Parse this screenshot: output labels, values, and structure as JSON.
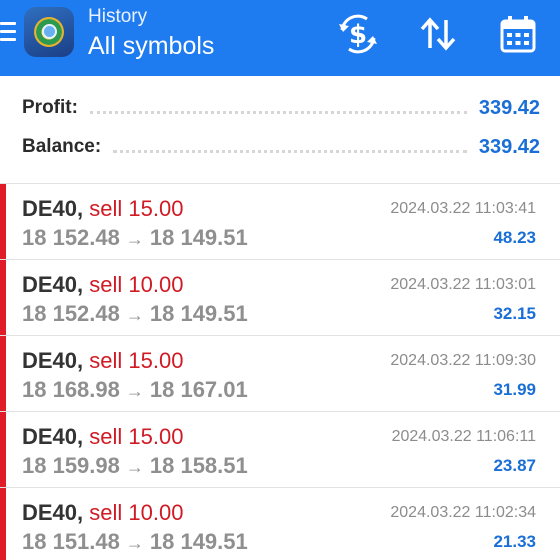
{
  "header": {
    "subtitle": "History",
    "title": "All symbols",
    "icons": [
      "menu-icon",
      "app-logo",
      "currency-exchange-icon",
      "sort-icon",
      "calendar-icon"
    ],
    "color": "#1f7bf0"
  },
  "summary": {
    "profit_label": "Profit:",
    "profit_value": "339.42",
    "balance_label": "Balance:",
    "balance_value": "339.42"
  },
  "trades": [
    {
      "symbol": "DE40",
      "side": "sell 15.00",
      "open": "18 152.48",
      "close": "18 149.51",
      "time": "2024.03.22 11:03:41",
      "profit": "48.23"
    },
    {
      "symbol": "DE40",
      "side": "sell 10.00",
      "open": "18 152.48",
      "close": "18 149.51",
      "time": "2024.03.22 11:03:01",
      "profit": "32.15"
    },
    {
      "symbol": "DE40",
      "side": "sell 15.00",
      "open": "18 168.98",
      "close": "18 167.01",
      "time": "2024.03.22 11:09:30",
      "profit": "31.99"
    },
    {
      "symbol": "DE40",
      "side": "sell 15.00",
      "open": "18 159.98",
      "close": "18 158.51",
      "time": "2024.03.22 11:06:11",
      "profit": "23.87"
    },
    {
      "symbol": "DE40",
      "side": "sell 10.00",
      "open": "18 151.48",
      "close": "18 149.51",
      "time": "2024.03.22 11:02:34",
      "profit": "21.33"
    }
  ],
  "colors": {
    "sell": "#d01b25",
    "profit": "#1a6fd6",
    "side_bar": "#e01c2a"
  }
}
